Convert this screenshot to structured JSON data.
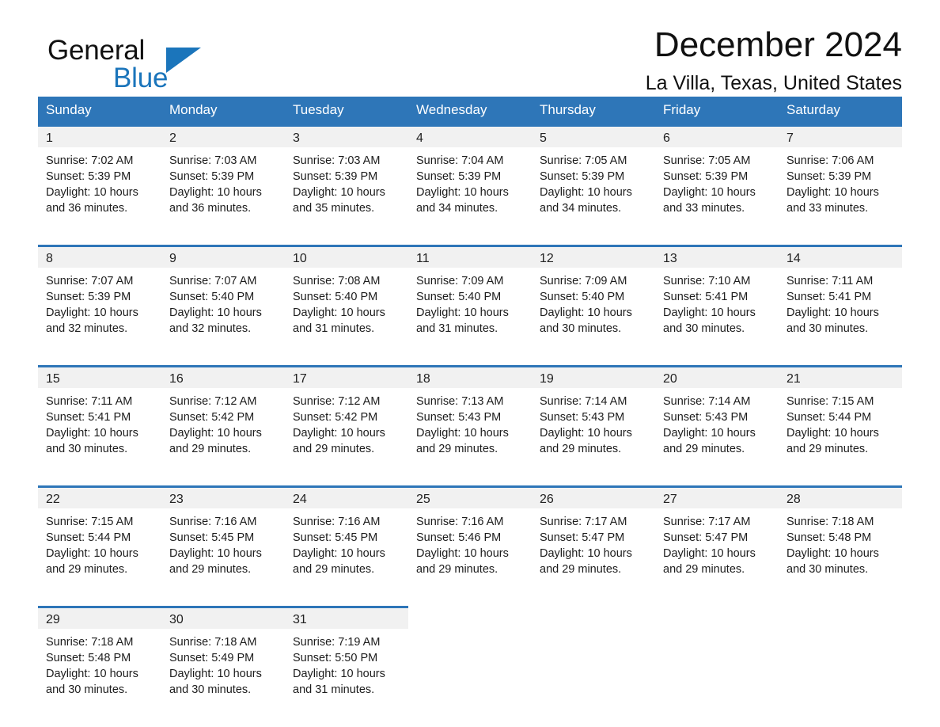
{
  "brand": {
    "name_part1": "General",
    "name_part2": "Blue",
    "logo_icon": "blue-triangle-logo",
    "accent_color": "#1b75bb"
  },
  "header": {
    "month_title": "December 2024",
    "location": "La Villa, Texas, United States"
  },
  "theme": {
    "header_row_color": "#2e76b8",
    "day_band_color": "#f1f1f1",
    "row_rule_color": "#2e76b8",
    "text_color": "#1c1c1c"
  },
  "weekday_headers": [
    "Sunday",
    "Monday",
    "Tuesday",
    "Wednesday",
    "Thursday",
    "Friday",
    "Saturday"
  ],
  "weeks": [
    [
      {
        "day": "1",
        "sunrise": "Sunrise: 7:02 AM",
        "sunset": "Sunset: 5:39 PM",
        "daylight_line1": "Daylight: 10 hours",
        "daylight_line2": "and 36 minutes."
      },
      {
        "day": "2",
        "sunrise": "Sunrise: 7:03 AM",
        "sunset": "Sunset: 5:39 PM",
        "daylight_line1": "Daylight: 10 hours",
        "daylight_line2": "and 36 minutes."
      },
      {
        "day": "3",
        "sunrise": "Sunrise: 7:03 AM",
        "sunset": "Sunset: 5:39 PM",
        "daylight_line1": "Daylight: 10 hours",
        "daylight_line2": "and 35 minutes."
      },
      {
        "day": "4",
        "sunrise": "Sunrise: 7:04 AM",
        "sunset": "Sunset: 5:39 PM",
        "daylight_line1": "Daylight: 10 hours",
        "daylight_line2": "and 34 minutes."
      },
      {
        "day": "5",
        "sunrise": "Sunrise: 7:05 AM",
        "sunset": "Sunset: 5:39 PM",
        "daylight_line1": "Daylight: 10 hours",
        "daylight_line2": "and 34 minutes."
      },
      {
        "day": "6",
        "sunrise": "Sunrise: 7:05 AM",
        "sunset": "Sunset: 5:39 PM",
        "daylight_line1": "Daylight: 10 hours",
        "daylight_line2": "and 33 minutes."
      },
      {
        "day": "7",
        "sunrise": "Sunrise: 7:06 AM",
        "sunset": "Sunset: 5:39 PM",
        "daylight_line1": "Daylight: 10 hours",
        "daylight_line2": "and 33 minutes."
      }
    ],
    [
      {
        "day": "8",
        "sunrise": "Sunrise: 7:07 AM",
        "sunset": "Sunset: 5:39 PM",
        "daylight_line1": "Daylight: 10 hours",
        "daylight_line2": "and 32 minutes."
      },
      {
        "day": "9",
        "sunrise": "Sunrise: 7:07 AM",
        "sunset": "Sunset: 5:40 PM",
        "daylight_line1": "Daylight: 10 hours",
        "daylight_line2": "and 32 minutes."
      },
      {
        "day": "10",
        "sunrise": "Sunrise: 7:08 AM",
        "sunset": "Sunset: 5:40 PM",
        "daylight_line1": "Daylight: 10 hours",
        "daylight_line2": "and 31 minutes."
      },
      {
        "day": "11",
        "sunrise": "Sunrise: 7:09 AM",
        "sunset": "Sunset: 5:40 PM",
        "daylight_line1": "Daylight: 10 hours",
        "daylight_line2": "and 31 minutes."
      },
      {
        "day": "12",
        "sunrise": "Sunrise: 7:09 AM",
        "sunset": "Sunset: 5:40 PM",
        "daylight_line1": "Daylight: 10 hours",
        "daylight_line2": "and 30 minutes."
      },
      {
        "day": "13",
        "sunrise": "Sunrise: 7:10 AM",
        "sunset": "Sunset: 5:41 PM",
        "daylight_line1": "Daylight: 10 hours",
        "daylight_line2": "and 30 minutes."
      },
      {
        "day": "14",
        "sunrise": "Sunrise: 7:11 AM",
        "sunset": "Sunset: 5:41 PM",
        "daylight_line1": "Daylight: 10 hours",
        "daylight_line2": "and 30 minutes."
      }
    ],
    [
      {
        "day": "15",
        "sunrise": "Sunrise: 7:11 AM",
        "sunset": "Sunset: 5:41 PM",
        "daylight_line1": "Daylight: 10 hours",
        "daylight_line2": "and 30 minutes."
      },
      {
        "day": "16",
        "sunrise": "Sunrise: 7:12 AM",
        "sunset": "Sunset: 5:42 PM",
        "daylight_line1": "Daylight: 10 hours",
        "daylight_line2": "and 29 minutes."
      },
      {
        "day": "17",
        "sunrise": "Sunrise: 7:12 AM",
        "sunset": "Sunset: 5:42 PM",
        "daylight_line1": "Daylight: 10 hours",
        "daylight_line2": "and 29 minutes."
      },
      {
        "day": "18",
        "sunrise": "Sunrise: 7:13 AM",
        "sunset": "Sunset: 5:43 PM",
        "daylight_line1": "Daylight: 10 hours",
        "daylight_line2": "and 29 minutes."
      },
      {
        "day": "19",
        "sunrise": "Sunrise: 7:14 AM",
        "sunset": "Sunset: 5:43 PM",
        "daylight_line1": "Daylight: 10 hours",
        "daylight_line2": "and 29 minutes."
      },
      {
        "day": "20",
        "sunrise": "Sunrise: 7:14 AM",
        "sunset": "Sunset: 5:43 PM",
        "daylight_line1": "Daylight: 10 hours",
        "daylight_line2": "and 29 minutes."
      },
      {
        "day": "21",
        "sunrise": "Sunrise: 7:15 AM",
        "sunset": "Sunset: 5:44 PM",
        "daylight_line1": "Daylight: 10 hours",
        "daylight_line2": "and 29 minutes."
      }
    ],
    [
      {
        "day": "22",
        "sunrise": "Sunrise: 7:15 AM",
        "sunset": "Sunset: 5:44 PM",
        "daylight_line1": "Daylight: 10 hours",
        "daylight_line2": "and 29 minutes."
      },
      {
        "day": "23",
        "sunrise": "Sunrise: 7:16 AM",
        "sunset": "Sunset: 5:45 PM",
        "daylight_line1": "Daylight: 10 hours",
        "daylight_line2": "and 29 minutes."
      },
      {
        "day": "24",
        "sunrise": "Sunrise: 7:16 AM",
        "sunset": "Sunset: 5:45 PM",
        "daylight_line1": "Daylight: 10 hours",
        "daylight_line2": "and 29 minutes."
      },
      {
        "day": "25",
        "sunrise": "Sunrise: 7:16 AM",
        "sunset": "Sunset: 5:46 PM",
        "daylight_line1": "Daylight: 10 hours",
        "daylight_line2": "and 29 minutes."
      },
      {
        "day": "26",
        "sunrise": "Sunrise: 7:17 AM",
        "sunset": "Sunset: 5:47 PM",
        "daylight_line1": "Daylight: 10 hours",
        "daylight_line2": "and 29 minutes."
      },
      {
        "day": "27",
        "sunrise": "Sunrise: 7:17 AM",
        "sunset": "Sunset: 5:47 PM",
        "daylight_line1": "Daylight: 10 hours",
        "daylight_line2": "and 29 minutes."
      },
      {
        "day": "28",
        "sunrise": "Sunrise: 7:18 AM",
        "sunset": "Sunset: 5:48 PM",
        "daylight_line1": "Daylight: 10 hours",
        "daylight_line2": "and 30 minutes."
      }
    ],
    [
      {
        "day": "29",
        "sunrise": "Sunrise: 7:18 AM",
        "sunset": "Sunset: 5:48 PM",
        "daylight_line1": "Daylight: 10 hours",
        "daylight_line2": "and 30 minutes."
      },
      {
        "day": "30",
        "sunrise": "Sunrise: 7:18 AM",
        "sunset": "Sunset: 5:49 PM",
        "daylight_line1": "Daylight: 10 hours",
        "daylight_line2": "and 30 minutes."
      },
      {
        "day": "31",
        "sunrise": "Sunrise: 7:19 AM",
        "sunset": "Sunset: 5:50 PM",
        "daylight_line1": "Daylight: 10 hours",
        "daylight_line2": "and 31 minutes."
      },
      {
        "day": "",
        "sunrise": "",
        "sunset": "",
        "daylight_line1": "",
        "daylight_line2": ""
      },
      {
        "day": "",
        "sunrise": "",
        "sunset": "",
        "daylight_line1": "",
        "daylight_line2": ""
      },
      {
        "day": "",
        "sunrise": "",
        "sunset": "",
        "daylight_line1": "",
        "daylight_line2": ""
      },
      {
        "day": "",
        "sunrise": "",
        "sunset": "",
        "daylight_line1": "",
        "daylight_line2": ""
      }
    ]
  ]
}
